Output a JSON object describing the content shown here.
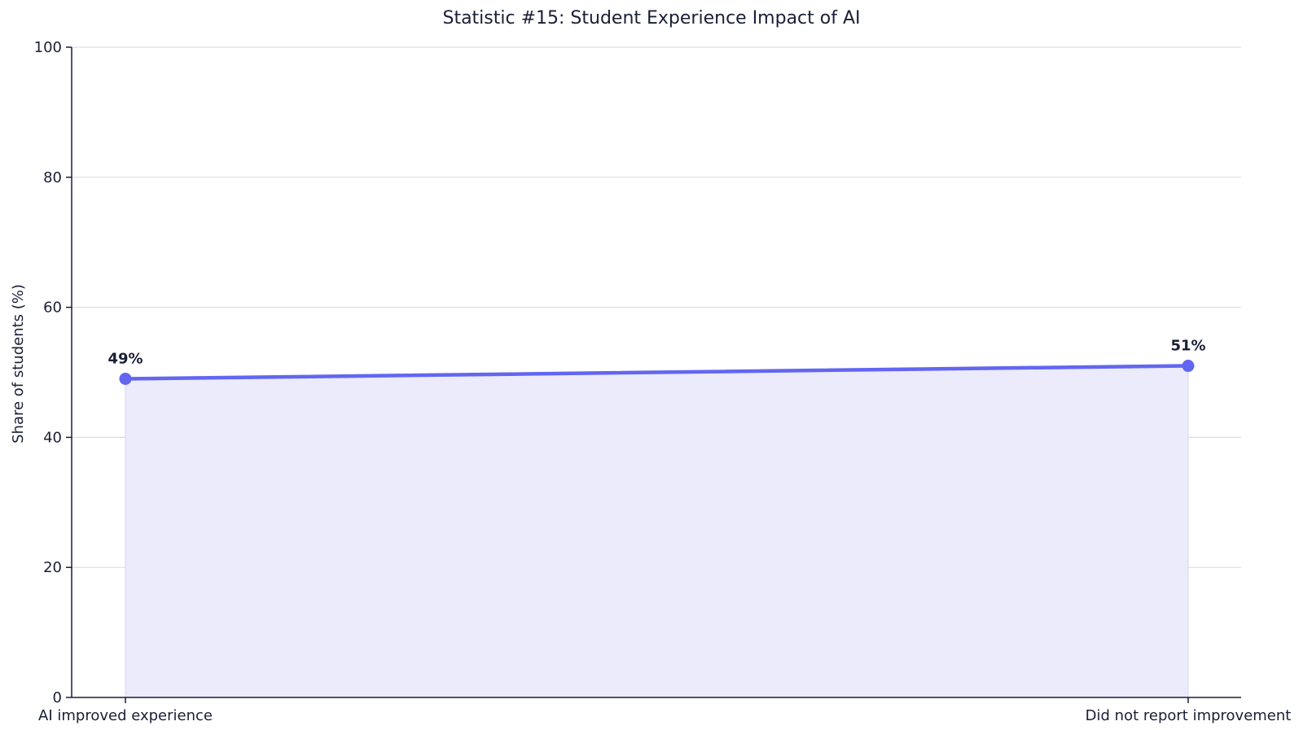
{
  "chart_data": {
    "type": "area",
    "title": "Statistic #15: Student Experience Impact of AI",
    "xlabel": "",
    "ylabel": "Share of students (%)",
    "categories": [
      "AI improved experience",
      "Did not report improvement"
    ],
    "values": [
      49,
      51
    ],
    "data_labels": [
      "49%",
      "51%"
    ],
    "ylim": [
      0,
      100
    ],
    "yticks": [
      0,
      20,
      40,
      60,
      80,
      100
    ],
    "grid": "horizontal",
    "colors": {
      "line": "#6366f1",
      "fill": "#ebebfb",
      "grid": "#dcdce6",
      "axis": "#1a1f36",
      "text": "#1a1f36"
    }
  }
}
